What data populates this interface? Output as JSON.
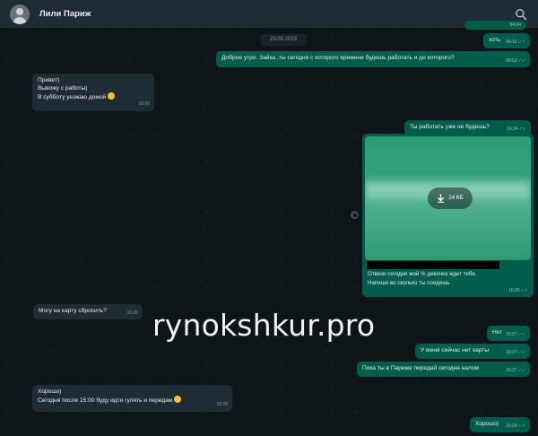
{
  "header": {
    "contact_name": "Лили Париж"
  },
  "chat": {
    "date": "23.03.2023",
    "top_partial": {
      "time": "04:04"
    },
    "messages": [
      {
        "id": "m1",
        "dir": "out",
        "text": "хоть",
        "time": "04:12"
      },
      {
        "id": "m2",
        "dir": "out",
        "text": "Доброе утро. Зайка ,ты сегодня с которого времени будешь работать и до которого?",
        "time": "09:53"
      },
      {
        "id": "m3",
        "dir": "in",
        "lines": [
          "Привет)",
          "Вывожу с работы)",
          "В субботу уезжаю домой"
        ],
        "time": "16:20"
      },
      {
        "id": "m4",
        "dir": "out",
        "text": "Ты работать уже не будешь?",
        "time": "16:24"
      },
      {
        "id": "m5",
        "dir": "out",
        "type": "media",
        "size": "24 KБ",
        "caption_lines": [
          "Отвези сегодня мой % девочка ждет тебя.",
          "Напиши во сколько ты поедешь"
        ],
        "time": "16:25"
      },
      {
        "id": "m6",
        "dir": "in",
        "text": "Могу на карту сбросить?",
        "time": "16:26"
      },
      {
        "id": "m7",
        "dir": "out",
        "text": "Нет",
        "time": "16:27"
      },
      {
        "id": "m8",
        "dir": "out",
        "text": "У меня сейчас нет карты",
        "time": "16:27"
      },
      {
        "id": "m9",
        "dir": "out",
        "text": "Пока ты в Париже передай сегодня налом",
        "time": "16:27"
      },
      {
        "id": "m10",
        "dir": "in",
        "lines": [
          "Хорошо)",
          "Сегодня после 15:00 буду идти гулять и передам"
        ],
        "time": "16:28"
      },
      {
        "id": "m11",
        "dir": "out",
        "text": "Хорошо)",
        "time": "16:29"
      }
    ]
  },
  "watermark": "rynokshkur.pro",
  "colors": {
    "outgoing": "#005c4b",
    "incoming": "#202c33",
    "background": "#0b141a",
    "ticks": "#53bdeb"
  },
  "icons": [
    "avatar",
    "search-icon",
    "download-icon",
    "read-ticks-icon",
    "forward-icon",
    "smiley-emoji"
  ]
}
